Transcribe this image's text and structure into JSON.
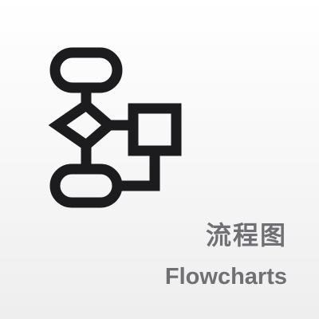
{
  "tile": {
    "title_cn": "流程图",
    "title_en": "Flowcharts",
    "icon": "flowchart-icon"
  },
  "colors": {
    "icon": "#1c1c1e",
    "text": "#6f6f74",
    "background_top": "#ffffff",
    "background_bottom": "#eeeeef"
  }
}
